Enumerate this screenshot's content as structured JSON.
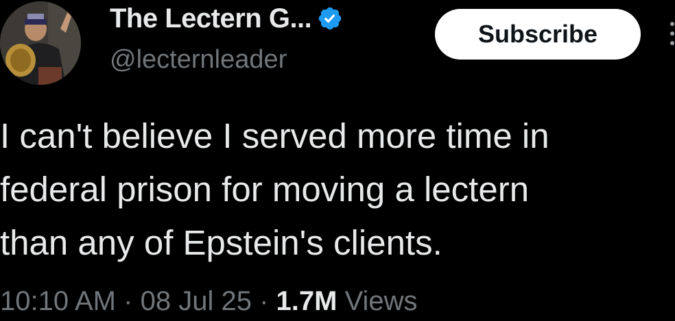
{
  "author": {
    "display_name": "The Lectern G...",
    "handle": "@lecternleader",
    "verified": true,
    "avatar_icon": "profile-photo"
  },
  "actions": {
    "subscribe_label": "Subscribe",
    "more_icon": "more-options-icon"
  },
  "tweet": {
    "lines": [
      "I can't believe I served more time in",
      "federal prison for moving a lectern",
      "than any of Epstein's clients."
    ]
  },
  "meta": {
    "time": "10:10 AM",
    "separator": "·",
    "date": "08 Jul 25",
    "views_count": "1.7M",
    "views_label": "Views"
  },
  "colors": {
    "background": "#000000",
    "primary_text": "#e7e9ea",
    "secondary_text": "#71767b",
    "verified_blue": "#1d9bf0",
    "button_bg": "#ffffff"
  }
}
